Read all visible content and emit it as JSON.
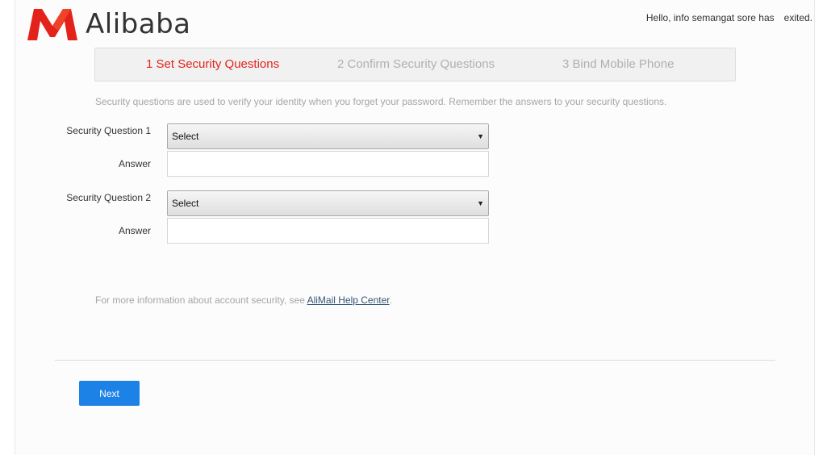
{
  "header": {
    "logo_text": "Alibaba",
    "greeting": "Hello, info semangat sore has",
    "exit_label": "exited."
  },
  "steps": [
    {
      "label": "1 Set Security Questions",
      "active": true
    },
    {
      "label": "2 Confirm Security Questions",
      "active": false
    },
    {
      "label": "3 Bind Mobile Phone",
      "active": false
    }
  ],
  "form": {
    "intro": "Security questions are used to verify your identity when you forget your password. Remember the answers to your security questions.",
    "question1": {
      "label": "Security Question 1",
      "selected": "Select",
      "answer_label": "Answer",
      "answer_value": ""
    },
    "question2": {
      "label": "Security Question 2",
      "selected": "Select",
      "answer_label": "Answer",
      "answer_value": ""
    }
  },
  "help": {
    "text": "For more information about account security, see ",
    "link_text": "AliMail Help Center",
    "suffix": "."
  },
  "actions": {
    "next_label": "Next"
  },
  "colors": {
    "brand_red": "#e3231b",
    "primary_button": "#1d82e6",
    "muted_text": "#a6a6a6"
  }
}
